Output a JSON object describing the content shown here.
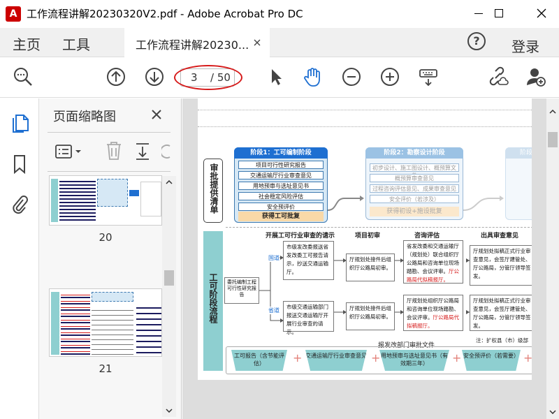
{
  "window": {
    "title": "工作流程讲解20230320V2.pdf - Adobe Acrobat Pro DC"
  },
  "tabs": {
    "home": "主页",
    "tools": "工具",
    "document": "工作流程讲解20230...",
    "login": "登录"
  },
  "toolbar": {
    "current_page": "3",
    "total_pages": "/ 50"
  },
  "thumbnails": {
    "title": "页面缩略图",
    "pages": [
      "20",
      "21"
    ]
  },
  "document": {
    "left_top": "审批提供清单",
    "left_bottom": "工可阶段流程",
    "stage1": {
      "title": "阶段1：工可编制阶段",
      "items": [
        "项目可行性研究报告",
        "交通运输厅行业审查意见",
        "用地预审与选址意见书",
        "社会稳定风险评估",
        "安全预评价"
      ],
      "result": "获得工可批复"
    },
    "stage2": {
      "title": "阶段2：勘察设计阶段",
      "items": [
        "初步设计、施工图设计、概预算文件",
        "概预算审查意见",
        "过程咨询评估意见、成果审查意见",
        "安全评价（若涉及）"
      ],
      "result": "获得初设+施设批复"
    },
    "stage3_title": "阶段",
    "headers": [
      "开展工可行业审查的请示",
      "项目初审",
      "咨询评估",
      "出具审查意见"
    ],
    "start_box": "委托编制工程可行性研究报告",
    "branch_top": "国道",
    "branch_bottom": "省道",
    "row1": {
      "request": "市级发改委报送省发改委工可报告请示，抄送交通运输厅。",
      "prelim": "厅规划处接件后组织厅公路局初审。",
      "consult": "省发改委和交通运输厅（规划处）联合组织厅公路局和咨询单位现场踏勘、会议评审。",
      "consult_red": "厅公路局代拟稿报厅。",
      "opinion": "厅规划处拟稿正式行业审查意见，会签厅建管处、厅公路局，分管厅领导签发。"
    },
    "row2": {
      "request": "市级交通运输部门报送交通运输厅开展行业审查的请示。",
      "prelim": "厅规划处接件后组织厅公路局初审。",
      "consult": "厅规划处组织厅公路局和咨询单位现场踏勘、会议评审。",
      "consult_red": "厅公路局代拟稿报厅。",
      "opinion": "厅规划处拟稿正式行业审查意见，会签厅建管处、厅公路局，分管厅领导签发。"
    },
    "note": "注：扩权县（市）级部",
    "bottom_title": "报发改部门审批文件",
    "bottom_items": [
      "工可报告（含节能评估）",
      "交通运输厅行业审查意见",
      "用地预审与选址意见书（有效期三年）",
      "安全预评价（若需要）"
    ],
    "plus": "+"
  },
  "colors": {
    "teal": "#8ecfd0",
    "blue": "#3d79b0",
    "red": "#d61a1a",
    "accent_blue": "#1e6fd1"
  }
}
